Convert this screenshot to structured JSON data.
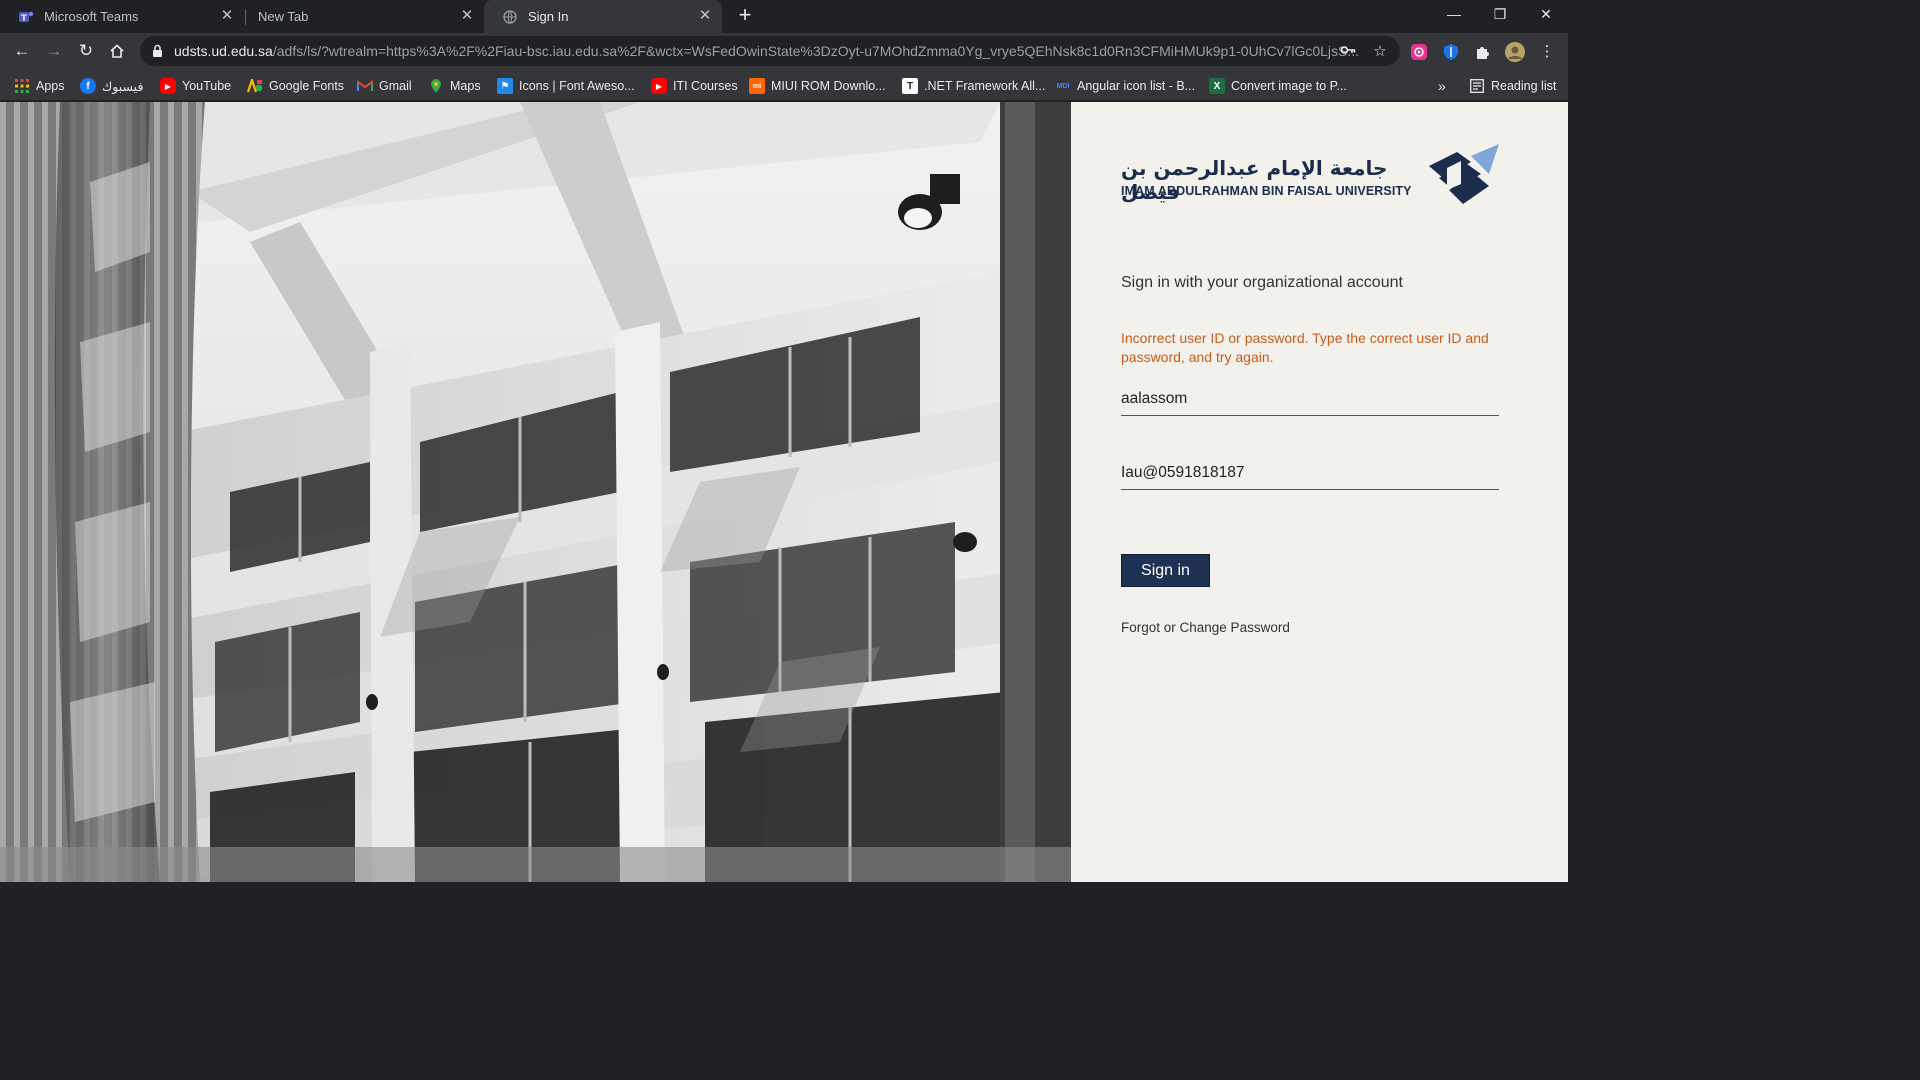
{
  "browser": {
    "tabs": [
      {
        "label": "Microsoft Teams",
        "icon": "teams-icon",
        "active": false
      },
      {
        "label": "New Tab",
        "icon": "",
        "active": false
      },
      {
        "label": "Sign In",
        "icon": "globe-icon",
        "active": true
      }
    ],
    "address": {
      "host": "udsts.ud.edu.sa",
      "path": "/adfs/ls/?wtrealm=https%3A%2F%2Fiau-bsc.iau.edu.sa%2F&wctx=WsFedOwinState%3DzOyt-u7MOhdZmma0Yg_vrye5QEhNsk8c1d0Rn3CFMiHMUk9p1-0UhCv7lGc0LjsS..."
    },
    "bookmarks": [
      {
        "label": "Apps",
        "icon": "apps-grid-icon"
      },
      {
        "label": "فيسبوك",
        "icon": "facebook-icon"
      },
      {
        "label": "YouTube",
        "icon": "youtube-icon"
      },
      {
        "label": "Google Fonts",
        "icon": "google-fonts-icon"
      },
      {
        "label": "Gmail",
        "icon": "gmail-icon"
      },
      {
        "label": "Maps",
        "icon": "maps-pin-icon"
      },
      {
        "label": "Icons | Font Aweso...",
        "icon": "flag-icon"
      },
      {
        "label": "ITI Courses",
        "icon": "youtube-icon"
      },
      {
        "label": "MIUI ROM Downlo...",
        "icon": "miui-icon"
      },
      {
        "label": ".NET Framework All...",
        "icon": "t-icon"
      },
      {
        "label": "Angular icon list - B...",
        "icon": "mdi-icon"
      },
      {
        "label": "Convert image to P...",
        "icon": "excel-icon"
      }
    ],
    "more_bookmarks": "»",
    "reading_list": "Reading list",
    "colors": {
      "frame": "#202124",
      "toolbar": "#35363a"
    }
  },
  "page": {
    "logo": {
      "arabic": "جامعة الإمام عبدالرحمن بن فيصل",
      "english": "IMAM ABDULRAHMAN BIN FAISAL UNIVERSITY"
    },
    "heading": "Sign in with your organizational account",
    "error": "Incorrect user ID or password. Type the correct user ID and password, and try again.",
    "username_value": "aalassom",
    "password_value": "Iau@0591818187",
    "signin_label": "Sign in",
    "forgot_label": "Forgot or Change Password",
    "colors": {
      "accent": "#1c3153",
      "error": "#c75d1a",
      "panel_bg": "#f3f1ec"
    }
  }
}
